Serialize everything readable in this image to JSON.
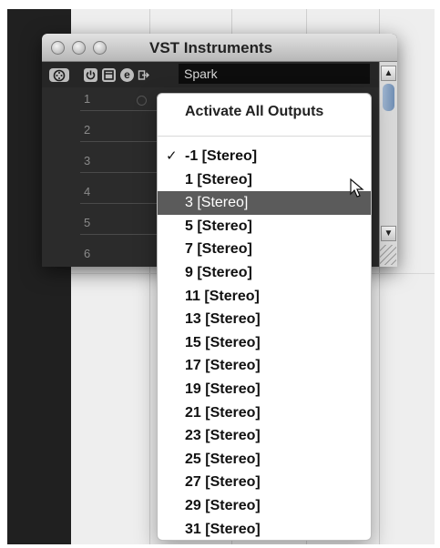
{
  "window": {
    "title": "VST Instruments",
    "instrument_name": "Spark"
  },
  "toolbar": {
    "icons": [
      "midi-icon",
      "power-icon",
      "edit-window-icon",
      "e-icon",
      "output-icon"
    ],
    "edit_glyph": "e"
  },
  "slots": [
    "1",
    "2",
    "3",
    "4",
    "5",
    "6"
  ],
  "menu": {
    "header": "Activate All Outputs",
    "selected_mark": "✓",
    "items": [
      "-1 [Stereo]",
      "1 [Stereo]",
      "3 [Stereo]",
      "5 [Stereo]",
      "7 [Stereo]",
      "9 [Stereo]",
      "11 [Stereo]",
      "13 [Stereo]",
      "15 [Stereo]",
      "17 [Stereo]",
      "19 [Stereo]",
      "21 [Stereo]",
      "23 [Stereo]",
      "25 [Stereo]",
      "27 [Stereo]",
      "29 [Stereo]",
      "31 [Stereo]"
    ],
    "checked_index": 0,
    "highlighted_index": 2
  },
  "colors": {
    "highlight": "#5b5b5b",
    "window_bg": "#2b2b2b",
    "titlebar": "#c8c8c8"
  }
}
